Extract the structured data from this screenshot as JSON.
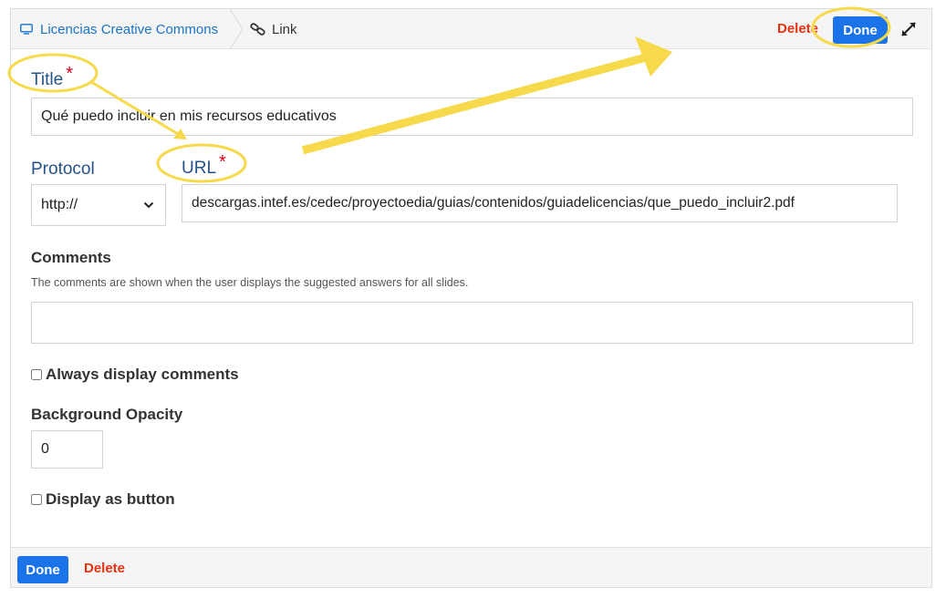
{
  "breadcrumb": {
    "root_label": "Licencias Creative Commons",
    "current_label": "Link"
  },
  "toolbar": {
    "delete_label": "Delete",
    "done_label": "Done"
  },
  "form": {
    "title": {
      "label": "Title",
      "required_mark": "*",
      "value": "Qué puedo incluir en mis recursos educativos"
    },
    "protocol": {
      "label": "Protocol",
      "selected": "http://"
    },
    "url": {
      "label": "URL",
      "required_mark": "*",
      "value": "descargas.intef.es/cedec/proyectoedia/guias/contenidos/guiadelicencias/que_puedo_incluir2.pdf"
    },
    "comments": {
      "label": "Comments",
      "description": "The comments are shown when the user displays the suggested answers for all slides.",
      "value": ""
    },
    "always_display_comments": {
      "label": "Always display comments",
      "checked": false
    },
    "background_opacity": {
      "label": "Background Opacity",
      "value": "0"
    },
    "display_as_button": {
      "label": "Display as button",
      "checked": false
    }
  },
  "footer": {
    "done_label": "Done",
    "delete_label": "Delete"
  },
  "colors": {
    "accent": "#1a73e8",
    "danger": "#e53012",
    "label_blue": "#24528a",
    "highlight": "#f7d94c"
  },
  "icons": {
    "root": "monitor-icon",
    "current": "link-icon",
    "fullscreen": "expand-icon",
    "dropdown": "chevron-down-icon"
  }
}
